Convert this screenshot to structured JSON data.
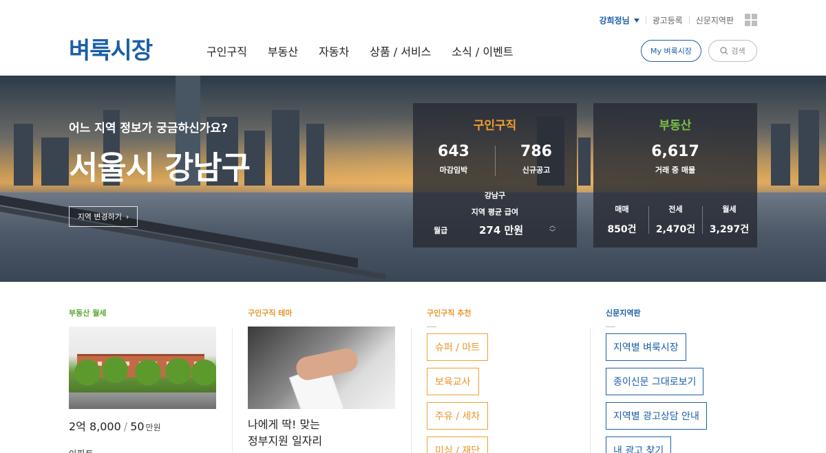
{
  "colors": {
    "brand": "#1a5ea8",
    "job_accent": "#f0a030",
    "realestate_accent": "#7bc043"
  },
  "util": {
    "user": "강희정님",
    "links": [
      "광고등록",
      "신문지역판"
    ]
  },
  "logo": "벼룩시장",
  "gnb": [
    "구인구직",
    "부동산",
    "자동차",
    "상품 / 서비스",
    "소식 / 이벤트"
  ],
  "header_buttons": {
    "my": "My 벼룩시장",
    "search": "검색"
  },
  "hero": {
    "subtitle": "어느 지역 정보가 궁금하신가요?",
    "title": "서울시 강남구",
    "change_region": "지역 변경하기",
    "job": {
      "title": "구인구직",
      "deadline_num": "643",
      "deadline_label": "마감임박",
      "new_num": "786",
      "new_label": "신규공고",
      "wage_region": "강남구",
      "wage_label": "지역 평균 급여",
      "wage_kind": "월급",
      "wage_value": "274 만원"
    },
    "realestate": {
      "title": "부동산",
      "total_num": "6,617",
      "total_label": "거래 중 매물",
      "sale_label": "매매",
      "sale_value": "850건",
      "jeonse_label": "전세",
      "jeonse_value": "2,470건",
      "monthly_label": "월세",
      "monthly_value": "3,297건"
    }
  },
  "sections": {
    "re_monthly": {
      "title": "부동산 월세",
      "price_main": "2억 8,000",
      "price_deposit_unit": "",
      "price_sep": "/",
      "price_monthly": "50",
      "price_unit": "만원",
      "type": "아파트"
    },
    "job_theme": {
      "title": "구인구직 테마",
      "line1": "나에게 딱! 맞는",
      "line2": "정부지원 일자리"
    },
    "job_reco": {
      "title": "구인구직 추천",
      "tags": [
        "슈퍼 / 마트",
        "보육교사",
        "주유 / 세차",
        "미싱 / 재단"
      ]
    },
    "paper": {
      "title": "신문지역판",
      "links": [
        "지역별 벼룩시장",
        "종이신문 그대로보기",
        "지역별 광고상담 안내",
        "내 광고 찾기"
      ]
    }
  }
}
